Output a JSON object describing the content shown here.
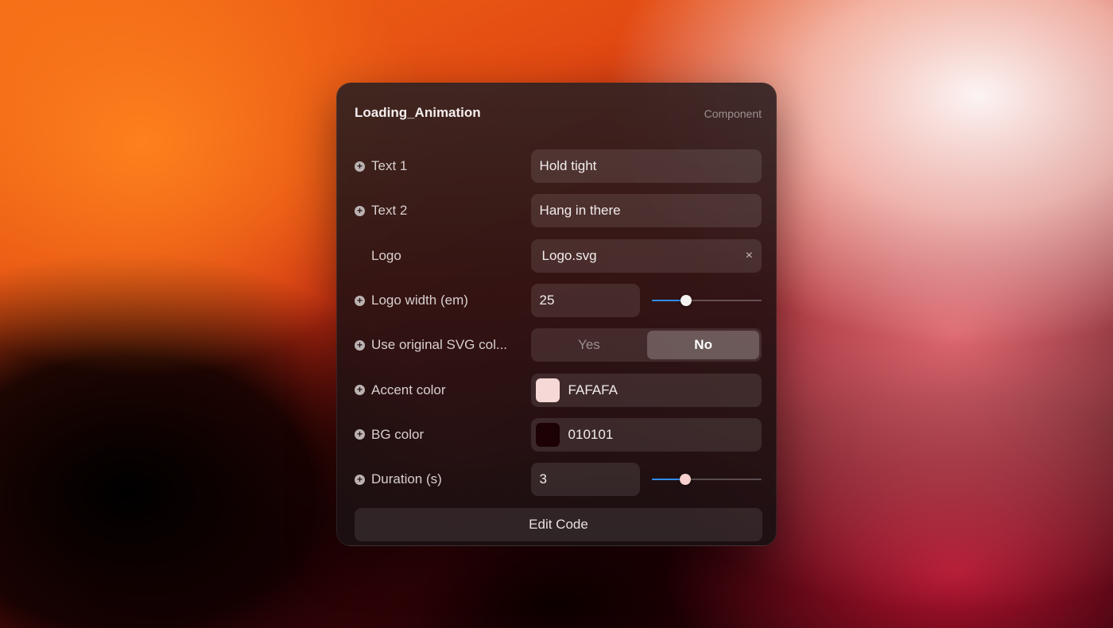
{
  "panel": {
    "title": "Loading_Animation",
    "type_label": "Component"
  },
  "icons": {
    "add": "plus-circle-icon",
    "clear": "close-icon"
  },
  "fields": {
    "text1": {
      "label": "Text 1",
      "value": "Hold tight"
    },
    "text2": {
      "label": "Text 2",
      "value": "Hang in there"
    },
    "logo": {
      "label": "Logo",
      "value": "Logo.svg",
      "clear_glyph": "×"
    },
    "logo_width": {
      "label": "Logo width (em)",
      "value": "25",
      "slider_fraction": 0.31
    },
    "use_original_svg": {
      "label": "Use original SVG col...",
      "options": [
        "Yes",
        "No"
      ],
      "selected": "No"
    },
    "accent_color": {
      "label": "Accent color",
      "value": "FAFAFA",
      "swatch": "#f6d9d6"
    },
    "bg_color": {
      "label": "BG color",
      "value": "010101",
      "swatch": "#1c0204"
    },
    "duration": {
      "label": "Duration (s)",
      "value": "3",
      "slider_fraction": 0.3
    }
  },
  "actions": {
    "edit_code": "Edit Code"
  },
  "colors": {
    "slider_accent": "#2f8cf2"
  }
}
